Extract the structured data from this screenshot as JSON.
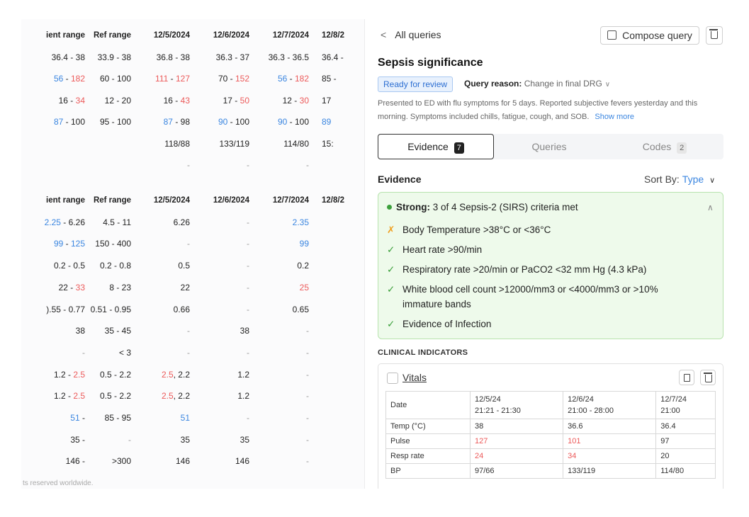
{
  "labs_vitals": {
    "headers": [
      "ient range",
      "Ref range",
      "12/5/2024",
      "12/6/2024",
      "12/7/2024",
      "12/8/2"
    ],
    "rows": [
      [
        {
          "t": "36.4 - 38"
        },
        {
          "t": "33.9 - 38"
        },
        {
          "t": "36.8 - 38"
        },
        {
          "t": "36.3 - 37"
        },
        {
          "t": "36.3 - 36.5"
        },
        {
          "t": "36.4 -"
        }
      ],
      [
        {
          "p": [
            {
              "t": "56",
              "c": "blue"
            },
            {
              "t": " - "
            },
            {
              "t": "182",
              "c": "red"
            }
          ]
        },
        {
          "t": "60 - 100"
        },
        {
          "p": [
            {
              "t": "111",
              "c": "red"
            },
            {
              "t": " - "
            },
            {
              "t": "127",
              "c": "red"
            }
          ]
        },
        {
          "p": [
            {
              "t": "70 - "
            },
            {
              "t": "152",
              "c": "red"
            }
          ]
        },
        {
          "p": [
            {
              "t": "56",
              "c": "blue"
            },
            {
              "t": " - "
            },
            {
              "t": "182",
              "c": "red"
            }
          ]
        },
        {
          "t": "85 -"
        }
      ],
      [
        {
          "p": [
            {
              "t": "16 - "
            },
            {
              "t": "34",
              "c": "red"
            }
          ]
        },
        {
          "t": "12 - 20"
        },
        {
          "p": [
            {
              "t": "16 - "
            },
            {
              "t": "43",
              "c": "red"
            }
          ]
        },
        {
          "p": [
            {
              "t": "17 - "
            },
            {
              "t": "50",
              "c": "red"
            }
          ]
        },
        {
          "p": [
            {
              "t": "12 - "
            },
            {
              "t": "30",
              "c": "red"
            }
          ]
        },
        {
          "t": "17"
        }
      ],
      [
        {
          "p": [
            {
              "t": "87",
              "c": "blue"
            },
            {
              "t": " - 100"
            }
          ]
        },
        {
          "t": "95 - 100"
        },
        {
          "p": [
            {
              "t": "87",
              "c": "blue"
            },
            {
              "t": " - 98"
            }
          ]
        },
        {
          "p": [
            {
              "t": "90",
              "c": "blue"
            },
            {
              "t": " - 100"
            }
          ]
        },
        {
          "p": [
            {
              "t": "90",
              "c": "blue"
            },
            {
              "t": " - 100"
            }
          ]
        },
        {
          "t": "89",
          "c": "blue"
        }
      ],
      [
        {
          "t": ""
        },
        {
          "t": ""
        },
        {
          "t": "118/88"
        },
        {
          "t": "133/119"
        },
        {
          "t": "114/80"
        },
        {
          "t": "15:"
        }
      ],
      [
        {
          "t": ""
        },
        {
          "t": ""
        },
        {
          "t": "-",
          "c": "muted"
        },
        {
          "t": "-",
          "c": "muted"
        },
        {
          "t": "-",
          "c": "muted"
        },
        {
          "t": ""
        }
      ]
    ]
  },
  "labs_chem": {
    "headers": [
      "ient range",
      "Ref range",
      "12/5/2024",
      "12/6/2024",
      "12/7/2024",
      "12/8/2"
    ],
    "rows": [
      [
        {
          "t": "2.25 - 6.26",
          "c": "blueStart"
        },
        {
          "t": "4.5 - 11"
        },
        {
          "t": "6.26"
        },
        {
          "t": "-",
          "c": "muted"
        },
        {
          "t": "2.35",
          "c": "blue"
        },
        {
          "t": ""
        }
      ],
      [
        {
          "p": [
            {
              "t": "99",
              "c": "blue"
            },
            {
              "t": " - "
            },
            {
              "t": "125",
              "c": "blue"
            }
          ]
        },
        {
          "t": "150 - 400"
        },
        {
          "t": "-",
          "c": "muted"
        },
        {
          "t": "-",
          "c": "muted"
        },
        {
          "t": "99",
          "c": "blue"
        },
        {
          "t": ""
        }
      ],
      [
        {
          "t": "0.2 - 0.5"
        },
        {
          "t": "0.2 - 0.8"
        },
        {
          "t": "0.5"
        },
        {
          "t": "-",
          "c": "muted"
        },
        {
          "t": "0.2"
        },
        {
          "t": ""
        }
      ],
      [
        {
          "p": [
            {
              "t": "22 - "
            },
            {
              "t": "33",
              "c": "red"
            }
          ]
        },
        {
          "t": "8 - 23"
        },
        {
          "t": "22"
        },
        {
          "t": "-",
          "c": "muted"
        },
        {
          "t": "25",
          "c": "red"
        },
        {
          "t": ""
        }
      ],
      [
        {
          "t": ").55 - 0.77"
        },
        {
          "t": "0.51 - 0.95"
        },
        {
          "t": "0.66"
        },
        {
          "t": "-",
          "c": "muted"
        },
        {
          "t": "0.65"
        },
        {
          "t": ""
        }
      ],
      [
        {
          "t": "38"
        },
        {
          "t": "35 - 45"
        },
        {
          "t": "-",
          "c": "muted"
        },
        {
          "t": "38"
        },
        {
          "t": "-",
          "c": "muted"
        },
        {
          "t": ""
        }
      ],
      [
        {
          "t": "-",
          "c": "muted"
        },
        {
          "t": "< 3"
        },
        {
          "t": "-",
          "c": "muted"
        },
        {
          "t": "-",
          "c": "muted"
        },
        {
          "t": "-",
          "c": "muted"
        },
        {
          "t": ""
        }
      ],
      [
        {
          "p": [
            {
              "t": "1.2 - "
            },
            {
              "t": "2.5",
              "c": "red"
            }
          ]
        },
        {
          "t": "0.5 - 2.2"
        },
        {
          "p": [
            {
              "t": "2.5",
              "c": "red"
            },
            {
              "t": ", 2.2"
            }
          ]
        },
        {
          "t": "1.2"
        },
        {
          "t": "-",
          "c": "muted"
        },
        {
          "t": ""
        }
      ],
      [
        {
          "p": [
            {
              "t": "1.2 - "
            },
            {
              "t": "2.5",
              "c": "red"
            }
          ]
        },
        {
          "t": "0.5 - 2.2"
        },
        {
          "p": [
            {
              "t": "2.5",
              "c": "red"
            },
            {
              "t": ", 2.2"
            }
          ]
        },
        {
          "t": "1.2"
        },
        {
          "t": "-",
          "c": "muted"
        },
        {
          "t": ""
        }
      ],
      [
        {
          "t": "51 -",
          "c": "blueStart"
        },
        {
          "t": "85 - 95"
        },
        {
          "t": "51",
          "c": "blue"
        },
        {
          "t": "-",
          "c": "muted"
        },
        {
          "t": "-",
          "c": "muted"
        },
        {
          "t": ""
        }
      ],
      [
        {
          "t": "35 -"
        },
        {
          "t": "-",
          "c": "muted"
        },
        {
          "t": "35"
        },
        {
          "t": "35"
        },
        {
          "t": "-",
          "c": "muted"
        },
        {
          "t": ""
        }
      ],
      [
        {
          "t": "146 -"
        },
        {
          "t": ">300"
        },
        {
          "t": "146"
        },
        {
          "t": "146"
        },
        {
          "t": "-",
          "c": "muted"
        },
        {
          "t": ""
        }
      ]
    ]
  },
  "footer": "ts reserved worldwide.",
  "panel": {
    "back_label": "All queries",
    "back_icon": "chevron-left-icon",
    "compose_label": "Compose query",
    "title": "Sepsis significance",
    "status": "Ready for review",
    "reason_label": "Query reason:",
    "reason_value": "Change in final DRG",
    "description": "Presented to ED with flu symptoms for 5 days. Reported subjective fevers yesterday and this morning. Symptoms included chills, fatigue, cough, and SOB.",
    "show_more": "Show more",
    "tabs": [
      {
        "label": "Evidence",
        "count": "7"
      },
      {
        "label": "Queries",
        "count": ""
      },
      {
        "label": "Codes",
        "count": "2"
      }
    ],
    "evidence_heading": "Evidence",
    "sort_label": "Sort By:",
    "sort_value": "Type",
    "criteria_strength": "Strong:",
    "criteria_summary": "3 of 4 Sepsis-2 (SIRS) criteria met",
    "criteria": [
      {
        "met": false,
        "text": "Body Temperature >38°C or <36°C"
      },
      {
        "met": true,
        "text": "Heart rate >90/min"
      },
      {
        "met": true,
        "text": "Respiratory rate >20/min or PaCO2 <32 mm Hg (4.3 kPa)"
      },
      {
        "met": true,
        "text": "White blood cell count >12000/mm3 or <4000/mm3 or >10% immature bands"
      },
      {
        "met": true,
        "text": "Evidence of Infection"
      }
    ],
    "clinical_heading": "CLINICAL INDICATORS",
    "vitals": {
      "name": "Vitals",
      "date_label": "Date",
      "columns": [
        {
          "date": "12/5/24",
          "time": "21:21 - 21:30"
        },
        {
          "date": "12/6/24",
          "time": "21:00 - 28:00"
        },
        {
          "date": "12/7/24",
          "time": "21:00"
        }
      ],
      "rows": [
        {
          "label": "Temp (°C)",
          "values": [
            "38",
            "36.6",
            "36.4"
          ],
          "flags": [
            false,
            false,
            false
          ]
        },
        {
          "label": "Pulse",
          "values": [
            "127",
            "101",
            "97"
          ],
          "flags": [
            true,
            true,
            false
          ]
        },
        {
          "label": "Resp rate",
          "values": [
            "24",
            "34",
            "20"
          ],
          "flags": [
            true,
            true,
            false
          ]
        },
        {
          "label": "BP",
          "values": [
            "97/66",
            "133/119",
            "114/80"
          ],
          "flags": [
            false,
            false,
            false
          ]
        }
      ]
    }
  },
  "colors": {
    "accent": "#3b86e0",
    "abnormal_high": "#ec5a5a",
    "met": "#3ca03c",
    "unmet": "#f0a020",
    "criteria_bg": "#eefaeb"
  }
}
